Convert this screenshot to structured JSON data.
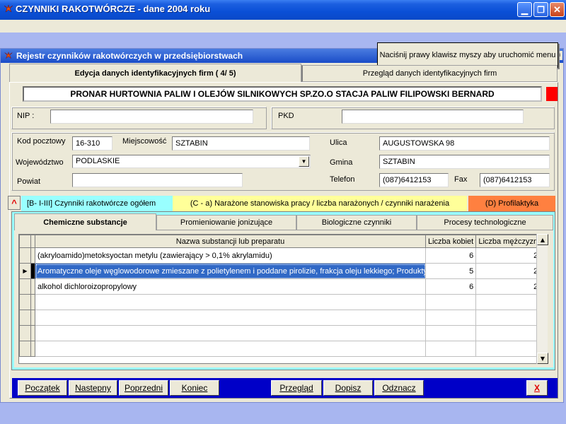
{
  "app": {
    "title": "CZYNNIKI RAKOTWÓRCZE  - dane 2004 roku"
  },
  "window": {
    "title": "Rejestr czynników rakotwórczych w przedsiębiorstwach"
  },
  "tooltip": "Naciśnij prawy klawisz myszy aby uruchomić menu",
  "top_tabs": [
    {
      "label": "Edycja danych identyfikacyjnych firm ( 4/ 5)",
      "active": true
    },
    {
      "label": "Przegląd danych identyfikacyjnych firm",
      "active": false
    }
  ],
  "firm_name": "PRONAR HURTOWNIA PALIW I OLEJÓW SILNIKOWYCH SP.ZO.O STACJA PALIW FILIPOWSKI BERNARD",
  "fields": {
    "nip": {
      "label": "NIP :",
      "value": ""
    },
    "pkd": {
      "label": "PKD",
      "value": ""
    },
    "kod": {
      "label": "Kod pocztowy",
      "value": "16-310"
    },
    "miejscowosc": {
      "label": "Miejscowość",
      "value": "SZTABIN"
    },
    "ulica": {
      "label": "Ulica",
      "value": "AUGUSTOWSKA 98"
    },
    "wojewodztwo": {
      "label": "Województwo",
      "value": "PODLASKIE"
    },
    "gmina": {
      "label": "Gmina",
      "value": "SZTABIN"
    },
    "powiat": {
      "label": "Powiat",
      "value": ""
    },
    "telefon": {
      "label": "Telefon",
      "value": "(087)6412153"
    },
    "fax": {
      "label": "Fax",
      "value": "(087)6412153"
    }
  },
  "section_toggle": "^",
  "section_tabs": [
    {
      "label": "[B- I-III]  Czynniki rakotwórcze ogółem",
      "color": "#99ffff"
    },
    {
      "label": "(C - a)  Narażone stanowiska pracy / liczba narażonych / czynniki narażenia",
      "color": "#ffff99"
    },
    {
      "label": "(D)  Profilaktyka",
      "color": "#ff8040"
    }
  ],
  "sub_tabs": [
    {
      "label": "Chemiczne substancje",
      "active": true
    },
    {
      "label": "Promieniowanie jonizujące",
      "active": false
    },
    {
      "label": "Biologiczne czynniki",
      "active": false
    },
    {
      "label": "Procesy technologiczne",
      "active": false
    }
  ],
  "grid": {
    "columns": [
      "Nazwa substancji lub preparatu",
      "Liczba kobiet",
      "Liczba mężczyzn"
    ],
    "rows": [
      {
        "name": "(akryloamido)metoksyoctan metylu (zawierający > 0,1% akrylamidu)",
        "kobiety": "6",
        "mezczyzni": "2",
        "selected": false
      },
      {
        "name": "Aromatyczne oleje węglowodorowe zmieszane z polietylenem i poddane pirolizie, frakcja oleju lekkiego; Produkty",
        "kobiety": "5",
        "mezczyzni": "2",
        "selected": true
      },
      {
        "name": "alkohol dichloroizopropylowy",
        "kobiety": "6",
        "mezczyzni": "2",
        "selected": false
      }
    ]
  },
  "buttons": {
    "poczatek": "Początek",
    "nastepny": "Nastepny",
    "poprzedni": "Poprzedni",
    "koniec": "Koniec",
    "przeglad": "Przegląd",
    "dopisz": "Dopisz",
    "odznacz": "Odznacz",
    "close": "X"
  },
  "colors": {
    "title_bar": "#0a4fd6",
    "accent_red": "#ff0000",
    "button_bar": "#0000c8",
    "selection": "#3169c6"
  }
}
